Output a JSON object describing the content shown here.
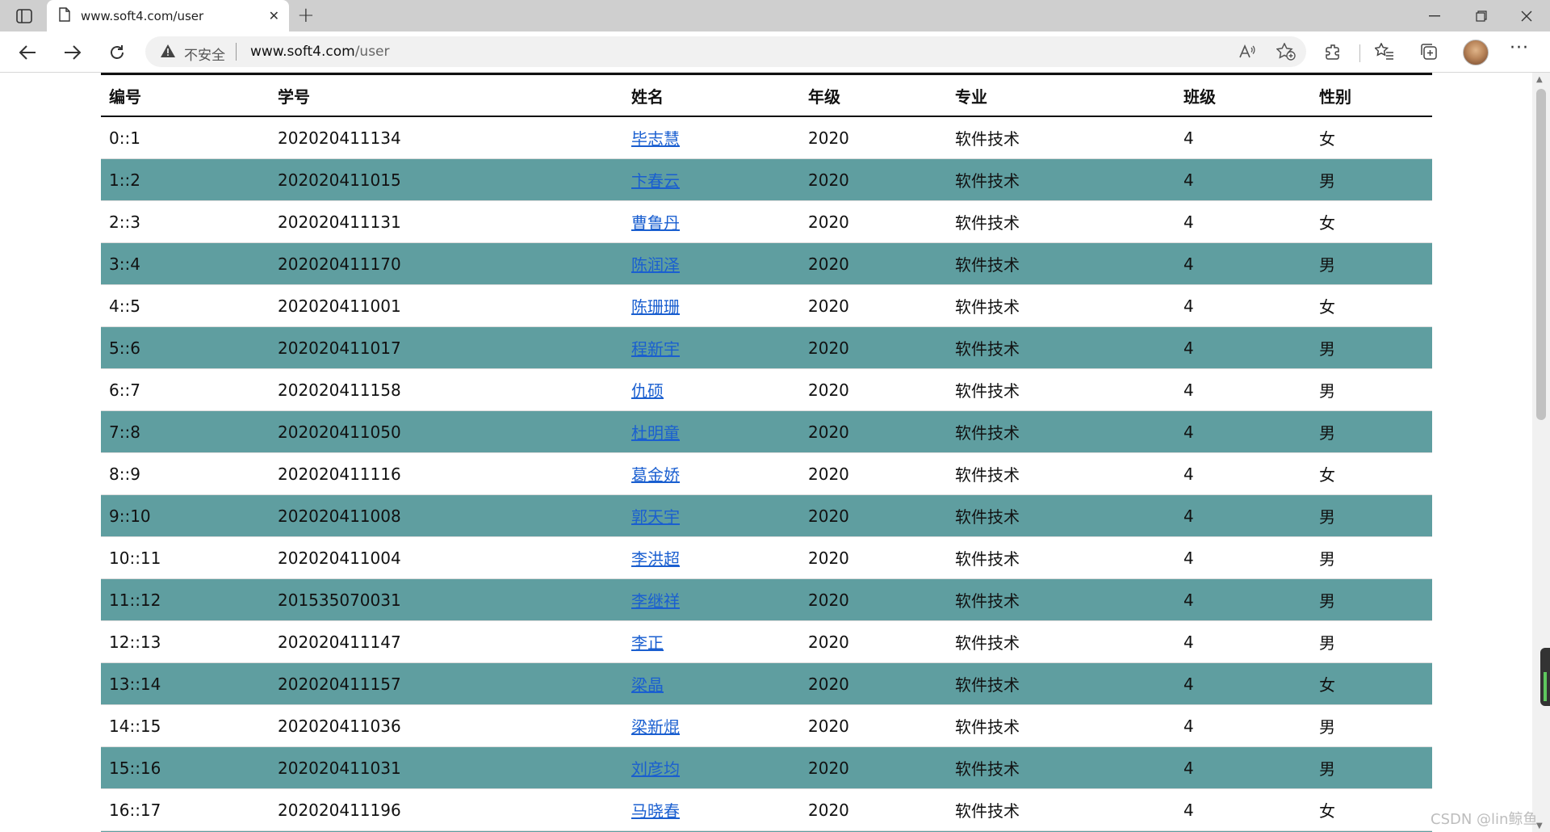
{
  "browser": {
    "tab_title": "www.soft4.com/user",
    "url_insecure_label": "不安全",
    "url_host": "www.soft4.com",
    "url_path": "/user",
    "watermark": "CSDN @lin鲸鱼"
  },
  "table": {
    "headers": [
      "编号",
      "学号",
      "姓名",
      "年级",
      "专业",
      "班级",
      "性别"
    ],
    "rows": [
      {
        "no": "0::1",
        "sid": "202020411134",
        "name": "毕志慧",
        "grade": "2020",
        "major": "软件技术",
        "class": "4",
        "gender": "女"
      },
      {
        "no": "1::2",
        "sid": "202020411015",
        "name": "卞春云",
        "grade": "2020",
        "major": "软件技术",
        "class": "4",
        "gender": "男"
      },
      {
        "no": "2::3",
        "sid": "202020411131",
        "name": "曹鲁丹",
        "grade": "2020",
        "major": "软件技术",
        "class": "4",
        "gender": "女"
      },
      {
        "no": "3::4",
        "sid": "202020411170",
        "name": "陈润泽",
        "grade": "2020",
        "major": "软件技术",
        "class": "4",
        "gender": "男"
      },
      {
        "no": "4::5",
        "sid": "202020411001",
        "name": "陈珊珊",
        "grade": "2020",
        "major": "软件技术",
        "class": "4",
        "gender": "女"
      },
      {
        "no": "5::6",
        "sid": "202020411017",
        "name": "程新宇",
        "grade": "2020",
        "major": "软件技术",
        "class": "4",
        "gender": "男"
      },
      {
        "no": "6::7",
        "sid": "202020411158",
        "name": "仇硕",
        "grade": "2020",
        "major": "软件技术",
        "class": "4",
        "gender": "男"
      },
      {
        "no": "7::8",
        "sid": "202020411050",
        "name": "杜明童",
        "grade": "2020",
        "major": "软件技术",
        "class": "4",
        "gender": "男"
      },
      {
        "no": "8::9",
        "sid": "202020411116",
        "name": "葛金娇",
        "grade": "2020",
        "major": "软件技术",
        "class": "4",
        "gender": "女"
      },
      {
        "no": "9::10",
        "sid": "202020411008",
        "name": "郭天宇",
        "grade": "2020",
        "major": "软件技术",
        "class": "4",
        "gender": "男"
      },
      {
        "no": "10::11",
        "sid": "202020411004",
        "name": "李洪超",
        "grade": "2020",
        "major": "软件技术",
        "class": "4",
        "gender": "男"
      },
      {
        "no": "11::12",
        "sid": "201535070031",
        "name": "李继祥",
        "grade": "2020",
        "major": "软件技术",
        "class": "4",
        "gender": "男"
      },
      {
        "no": "12::13",
        "sid": "202020411147",
        "name": "李正",
        "grade": "2020",
        "major": "软件技术",
        "class": "4",
        "gender": "男"
      },
      {
        "no": "13::14",
        "sid": "202020411157",
        "name": "梁晶",
        "grade": "2020",
        "major": "软件技术",
        "class": "4",
        "gender": "女"
      },
      {
        "no": "14::15",
        "sid": "202020411036",
        "name": "梁新焜",
        "grade": "2020",
        "major": "软件技术",
        "class": "4",
        "gender": "男"
      },
      {
        "no": "15::16",
        "sid": "202020411031",
        "name": "刘彦均",
        "grade": "2020",
        "major": "软件技术",
        "class": "4",
        "gender": "男"
      },
      {
        "no": "16::17",
        "sid": "202020411196",
        "name": "马晓春",
        "grade": "2020",
        "major": "软件技术",
        "class": "4",
        "gender": "女"
      },
      {
        "no": "",
        "sid": "",
        "name": "",
        "grade": "",
        "major": "",
        "class": "",
        "gender": ""
      }
    ]
  },
  "colors": {
    "alt_row": "#5f9ea0",
    "link": "#1a5fd0"
  }
}
